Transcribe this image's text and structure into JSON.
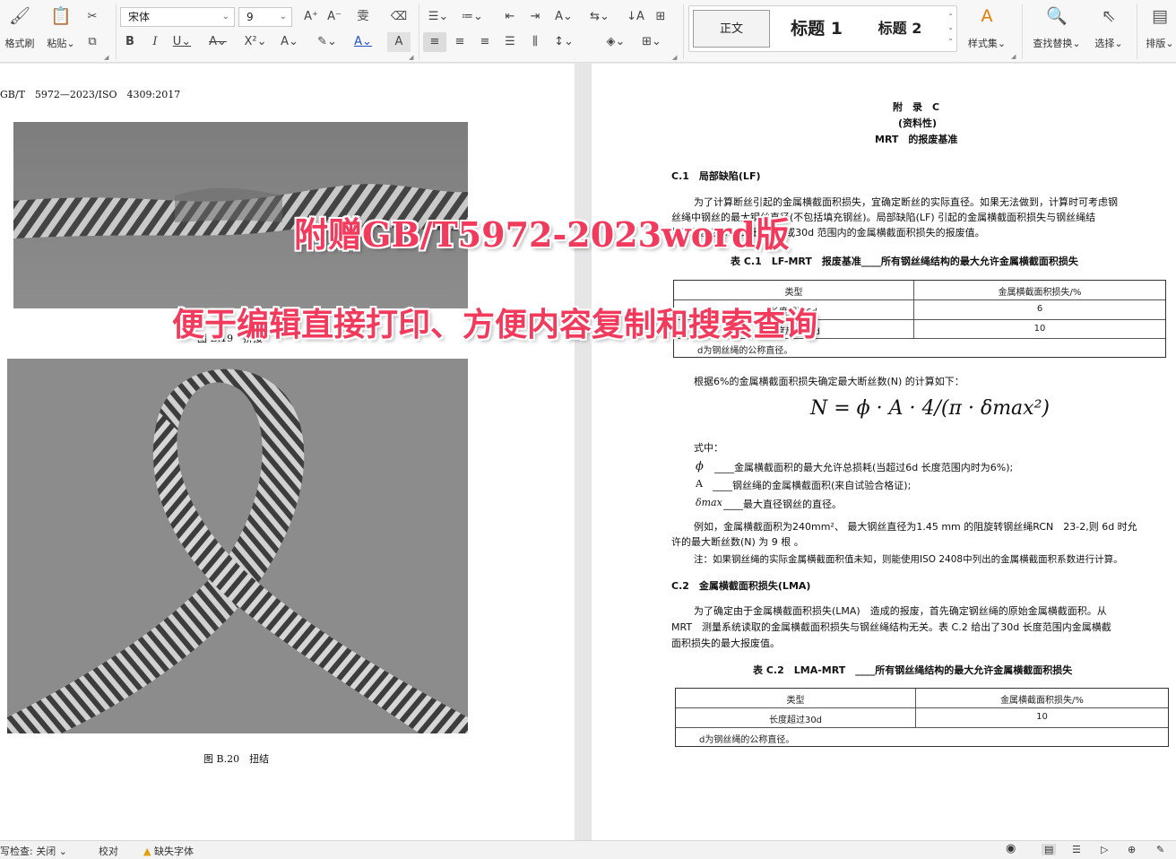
{
  "ribbon": {
    "format_painter": "格式刷",
    "paste": "粘贴",
    "font_name": "宋体",
    "font_size": "9",
    "styles": {
      "normal": "正文",
      "heading1": "标题 1",
      "heading2": "标题 2"
    },
    "style_set": "样式集",
    "find_replace": "查找替换",
    "select": "选择",
    "arrange": "排版"
  },
  "left_page": {
    "header": "GB/T　5972—2023/ISO　4309:2017",
    "figure_caption": "图 B.20　扭结",
    "partial_caption": "图 B.19　拼接"
  },
  "right_page": {
    "appendix_title": "附　录　C",
    "appendix_type": "(资料性)",
    "appendix_subject": "MRT　的报废基准",
    "sec_c1_title": "C.1　局部缺陷(LF)",
    "sec_c1_p1": "为了计算断丝引起的金属横截面积损失，宜确定断丝的实际直径。如果无法做到，计算时可考虑钢",
    "sec_c1_p2": "丝绳中钢丝的最大钢丝直径(不包括填充钢丝)。局部缺陷(LF) 引起的金属横截面积损失与钢丝绳结",
    "sec_c1_p3": "构无关。表C.1 给出了6d 或30d 范围内的金属横截面积损失的报废值。",
    "table_c1_title": "表 C.1　LF-MRT　报废基准____所有钢丝绳结构的最大允许金属横截面积损失",
    "table_c1": {
      "col1": "类型",
      "col2": "金属横截面积损失/%",
      "rows": [
        [
          "长度超过6d",
          "6"
        ],
        [
          "长度超过30d",
          "10"
        ]
      ],
      "note": "d为钢丝绳的公称直径。"
    },
    "calc_intro": "根据6%的金属横截面积损失确定最大断丝数(N) 的计算如下：",
    "formula": "N = ϕ · A · 4/(π · δmax²)",
    "where": "式中：",
    "var_phi_sym": "ϕ",
    "var_phi": "____金属横截面积的最大允许总损耗(当超过6d 长度范围内时为6%);",
    "var_a_sym": "A",
    "var_a": "____钢丝绳的金属横截面积(来自试验合格证);",
    "var_d_sym": "δmax",
    "var_d": "____最大直径钢丝的直径。",
    "example_1": "例如，金属横截面积为240mm²、 最大钢丝直径为1.45 mm 的阻旋转钢丝绳RCN　23-2,则 6d 时允",
    "example_2": "许的最大断丝数(N) 为 9 根 。",
    "note": "注：如果钢丝绳的实际金属横截面积值未知，则能使用ISO 2408中列出的金属横截面积系数进行计算。",
    "sec_c2_title": "C.2　金属横截面积损失(LMA)",
    "sec_c2_p1": "为了确定由于金属横截面积损失(LMA)　造成的报废，首先确定钢丝绳的原始金属横截面积。从",
    "sec_c2_p2": "MRT　测量系统读取的金属横截面积损失与钢丝绳结构无关。表 C.2 给出了30d 长度范围内金属横截",
    "sec_c2_p3": "面积损失的最大报废值。",
    "table_c2_title": "表 C.2　LMA-MRT　____所有钢丝绳结构的最大允许金属横截面积损失",
    "table_c2": {
      "col1": "类型",
      "col2": "金属横截面积损失/%",
      "rows": [
        [
          "长度超过30d",
          "10"
        ]
      ],
      "note": "d为钢丝绳的公称直径。"
    }
  },
  "overlay": {
    "line1": "附赠GB/T5972-2023word版",
    "line2": "便于编辑直接打印、方便内容复制和搜索查询"
  },
  "statusbar": {
    "spellcheck": "写检查: 关闭",
    "proofread": "校对",
    "missing_font": "缺失字体"
  },
  "colors": {
    "overlay_red": "#f23a5c",
    "ribbon_bg": "#f7f7f7",
    "font_color_underline": "#1f4fd1"
  }
}
